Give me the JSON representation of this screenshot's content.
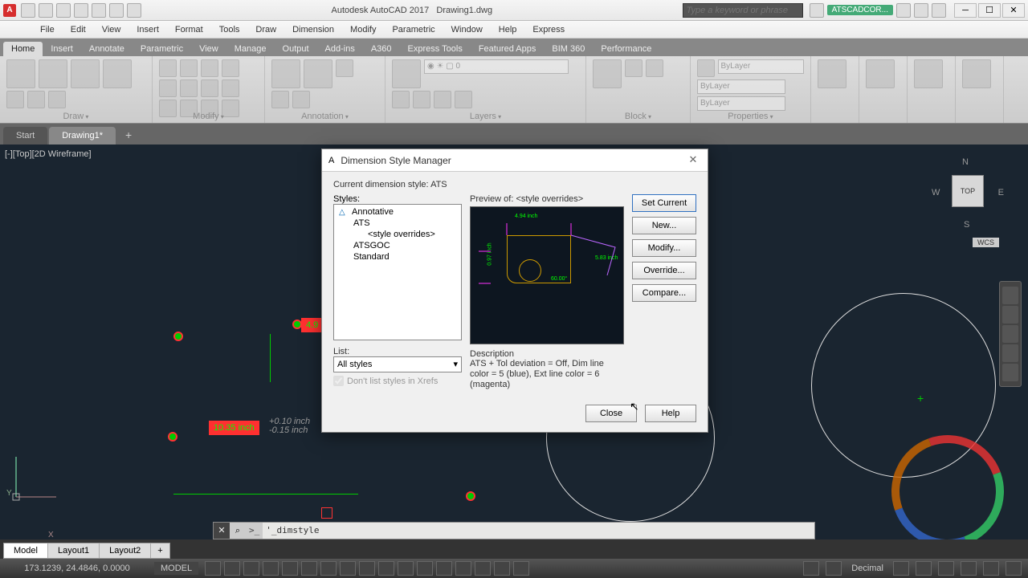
{
  "title": {
    "app": "Autodesk AutoCAD 2017",
    "file": "Drawing1.dwg"
  },
  "search": {
    "placeholder": "Type a keyword or phrase"
  },
  "user": {
    "name": "ATSCADCOR..."
  },
  "menus": [
    "File",
    "Edit",
    "View",
    "Insert",
    "Format",
    "Tools",
    "Draw",
    "Dimension",
    "Modify",
    "Parametric",
    "Window",
    "Help",
    "Express"
  ],
  "ribbon_tabs": [
    "Home",
    "Insert",
    "Annotate",
    "Parametric",
    "View",
    "Manage",
    "Output",
    "Add-ins",
    "A360",
    "Express Tools",
    "Featured Apps",
    "BIM 360",
    "Performance"
  ],
  "panels": {
    "draw": "Draw",
    "modify": "Modify",
    "annotation": "Annotation",
    "layers": "Layers",
    "block": "Block",
    "properties": "Properties"
  },
  "props": {
    "bylayer": "ByLayer"
  },
  "filetabs": {
    "start": "Start",
    "drawing": "Drawing1*"
  },
  "viewport": {
    "label": "[-][Top][2D Wireframe]"
  },
  "viewcube": {
    "n": "N",
    "s": "S",
    "e": "E",
    "w": "W",
    "top": "TOP",
    "wcs": "WCS"
  },
  "dims": {
    "d1": "4.9",
    "d2": "10.35 inch",
    "tol_plus": "+0.10 inch",
    "tol_minus": "-0.15 inch"
  },
  "cmd": {
    "prompt": ">_",
    "text": "'_dimstyle"
  },
  "modeltabs": [
    "Model",
    "Layout1",
    "Layout2"
  ],
  "status": {
    "coords": "173.1239, 24.4846, 0.0000",
    "mode": "MODEL",
    "units": "Decimal"
  },
  "dialog": {
    "title": "Dimension Style Manager",
    "current_label": "Current dimension style:",
    "current_value": "ATS",
    "styles_label": "Styles:",
    "styles": [
      "Annotative",
      "ATS",
      "<style overrides>",
      "ATSGOC",
      "Standard"
    ],
    "preview_label": "Preview of:  <style overrides>",
    "buttons": {
      "set_current": "Set Current",
      "new": "New...",
      "modify": "Modify...",
      "override": "Override...",
      "compare": "Compare..."
    },
    "list_label": "List:",
    "list_value": "All styles",
    "xrefs": "Don't list styles in Xrefs",
    "desc_label": "Description",
    "desc_text": "ATS + Tol deviation = Off, Dim line color = 5 (blue), Ext line color = 6 (magenta)",
    "close": "Close",
    "help": "Help"
  }
}
